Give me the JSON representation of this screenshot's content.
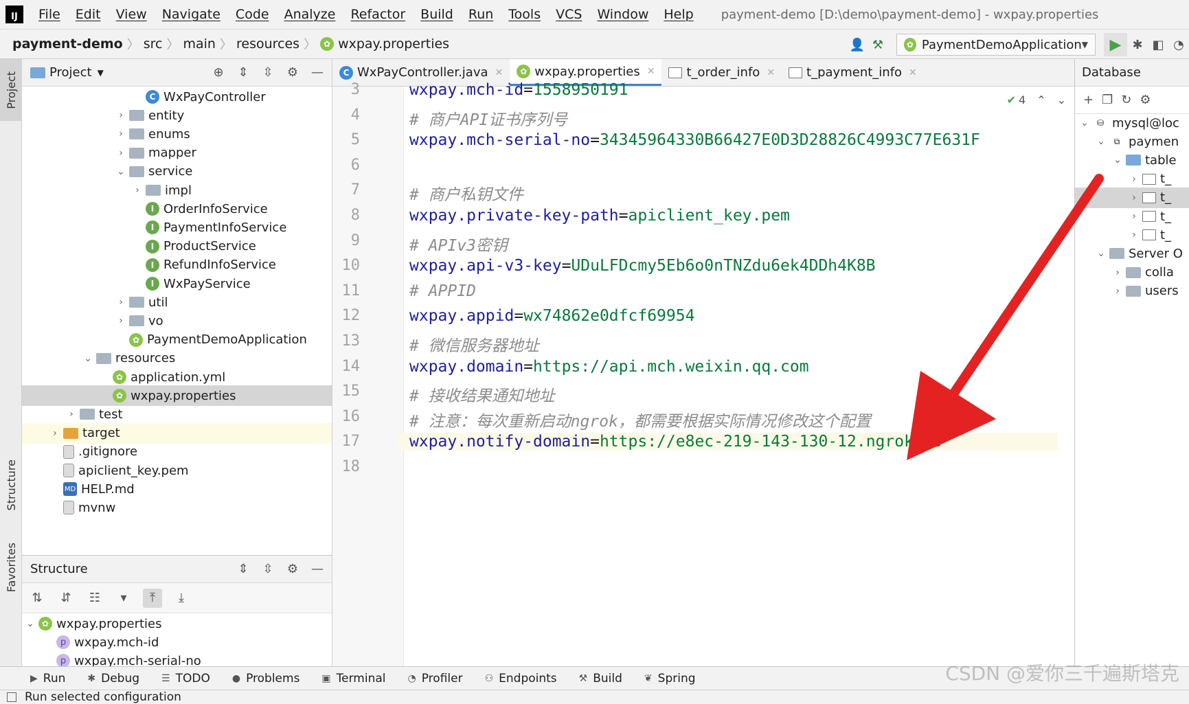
{
  "app": {
    "logo": "IJ",
    "menu": [
      "File",
      "Edit",
      "View",
      "Navigate",
      "Code",
      "Analyze",
      "Refactor",
      "Build",
      "Run",
      "Tools",
      "VCS",
      "Window",
      "Help"
    ],
    "window_title": "payment-demo [D:\\demo\\payment-demo] - wxpay.properties"
  },
  "breadcrumb": [
    "payment-demo",
    "src",
    "main",
    "resources",
    "wxpay.properties"
  ],
  "run_config": "PaymentDemoApplication",
  "left_stripe": {
    "project": "Project",
    "structure": "Structure",
    "favorites": "Favorites"
  },
  "project_panel": {
    "title": "Project",
    "tree": [
      {
        "label": "WxPayController",
        "indent": 7,
        "icon": "class",
        "arrow": ""
      },
      {
        "label": "entity",
        "indent": 6,
        "icon": "folder",
        "arrow": ">"
      },
      {
        "label": "enums",
        "indent": 6,
        "icon": "folder",
        "arrow": ">"
      },
      {
        "label": "mapper",
        "indent": 6,
        "icon": "folder",
        "arrow": ">"
      },
      {
        "label": "service",
        "indent": 6,
        "icon": "folder",
        "arrow": "v"
      },
      {
        "label": "impl",
        "indent": 7,
        "icon": "folder",
        "arrow": ">"
      },
      {
        "label": "OrderInfoService",
        "indent": 7,
        "icon": "iface",
        "arrow": ""
      },
      {
        "label": "PaymentInfoService",
        "indent": 7,
        "icon": "iface",
        "arrow": ""
      },
      {
        "label": "ProductService",
        "indent": 7,
        "icon": "iface",
        "arrow": ""
      },
      {
        "label": "RefundInfoService",
        "indent": 7,
        "icon": "iface",
        "arrow": ""
      },
      {
        "label": "WxPayService",
        "indent": 7,
        "icon": "iface",
        "arrow": ""
      },
      {
        "label": "util",
        "indent": 6,
        "icon": "folder",
        "arrow": ">"
      },
      {
        "label": "vo",
        "indent": 6,
        "icon": "folder",
        "arrow": ">"
      },
      {
        "label": "PaymentDemoApplication",
        "indent": 6,
        "icon": "spring",
        "arrow": ""
      },
      {
        "label": "resources",
        "indent": 4,
        "icon": "folder",
        "arrow": "v"
      },
      {
        "label": "application.yml",
        "indent": 5,
        "icon": "spring",
        "arrow": ""
      },
      {
        "label": "wxpay.properties",
        "indent": 5,
        "icon": "spring",
        "arrow": "",
        "selected": true
      },
      {
        "label": "test",
        "indent": 3,
        "icon": "folder",
        "arrow": ">"
      },
      {
        "label": "target",
        "indent": 2,
        "icon": "folder-orange",
        "arrow": ">",
        "highlight": true
      },
      {
        "label": ".gitignore",
        "indent": 2,
        "icon": "file",
        "arrow": ""
      },
      {
        "label": "apiclient_key.pem",
        "indent": 2,
        "icon": "file",
        "arrow": ""
      },
      {
        "label": "HELP.md",
        "indent": 2,
        "icon": "md",
        "arrow": ""
      },
      {
        "label": "mvnw",
        "indent": 2,
        "icon": "file",
        "arrow": ""
      }
    ]
  },
  "structure_panel": {
    "title": "Structure",
    "tree": [
      {
        "label": "wxpay.properties",
        "arrow": "v",
        "icon": "spring",
        "indent": 0
      },
      {
        "label": "wxpay.mch-id",
        "arrow": "",
        "icon": "prop",
        "indent": 1
      },
      {
        "label": "wxpay.mch-serial-no",
        "arrow": "",
        "icon": "prop",
        "indent": 1
      }
    ]
  },
  "editor_tabs": [
    {
      "label": "WxPayController.java",
      "icon": "class",
      "active": false
    },
    {
      "label": "wxpay.properties",
      "icon": "spring",
      "active": true
    },
    {
      "label": "t_order_info",
      "icon": "table",
      "active": false
    },
    {
      "label": "t_payment_info",
      "icon": "table",
      "active": false
    }
  ],
  "editor": {
    "inspection_count": "4",
    "lines": [
      {
        "no": "3",
        "key": "wxpay.mch-id",
        "eq": "=",
        "val": "1558950191",
        "comment": ""
      },
      {
        "no": "4",
        "key": "",
        "eq": "",
        "val": "",
        "comment": "# 商户API证书序列号"
      },
      {
        "no": "5",
        "key": "wxpay.mch-serial-no",
        "eq": "=",
        "val": "34345964330B66427E0D3D28826C4993C77E631F",
        "comment": ""
      },
      {
        "no": "6",
        "key": "",
        "eq": "",
        "val": "",
        "comment": ""
      },
      {
        "no": "7",
        "key": "",
        "eq": "",
        "val": "",
        "comment": "# 商户私钥文件"
      },
      {
        "no": "8",
        "key": "wxpay.private-key-path",
        "eq": "=",
        "val": "apiclient_key.pem",
        "comment": ""
      },
      {
        "no": "9",
        "key": "",
        "eq": "",
        "val": "",
        "comment": "# APIv3密钥"
      },
      {
        "no": "10",
        "key": "wxpay.api-v3-key",
        "eq": "=",
        "val": "UDuLFDcmy5Eb6o0nTNZdu6ek4DDh4K8B",
        "comment": ""
      },
      {
        "no": "11",
        "key": "",
        "eq": "",
        "val": "",
        "comment": "# APPID"
      },
      {
        "no": "12",
        "key": "wxpay.appid",
        "eq": "=",
        "val": "wx74862e0dfcf69954",
        "comment": ""
      },
      {
        "no": "13",
        "key": "",
        "eq": "",
        "val": "",
        "comment": "# 微信服务器地址"
      },
      {
        "no": "14",
        "key": "wxpay.domain",
        "eq": "=",
        "val": "https://api.mch.weixin.qq.com",
        "comment": ""
      },
      {
        "no": "15",
        "key": "",
        "eq": "",
        "val": "",
        "comment": "# 接收结果通知地址"
      },
      {
        "no": "16",
        "key": "",
        "eq": "",
        "val": "",
        "comment": "# 注意：每次重新启动ngrok，都需要根据实际情况修改这个配置"
      },
      {
        "no": "17",
        "key": "wxpay.notify-domain",
        "eq": "=",
        "val": "https://e8ec-219-143-130-12.ngrok.io",
        "comment": "",
        "current": true
      },
      {
        "no": "18",
        "key": "",
        "eq": "",
        "val": "",
        "comment": ""
      }
    ]
  },
  "database_panel": {
    "title": "Database",
    "tree": [
      {
        "label": "mysql@loc",
        "arrow": "v",
        "icon": "db",
        "indent": 0
      },
      {
        "label": "paymen",
        "arrow": "v",
        "icon": "schema",
        "indent": 1
      },
      {
        "label": "table",
        "arrow": "v",
        "icon": "folderblue",
        "indent": 2
      },
      {
        "label": "t_",
        "arrow": ">",
        "icon": "table",
        "indent": 3
      },
      {
        "label": "t_",
        "arrow": ">",
        "icon": "table",
        "indent": 3,
        "selected": true
      },
      {
        "label": "t_",
        "arrow": ">",
        "icon": "table",
        "indent": 3
      },
      {
        "label": "t_",
        "arrow": ">",
        "icon": "table",
        "indent": 3
      },
      {
        "label": "Server O",
        "arrow": "v",
        "icon": "folder",
        "indent": 1
      },
      {
        "label": "colla",
        "arrow": ">",
        "icon": "folder",
        "indent": 2
      },
      {
        "label": "users",
        "arrow": ">",
        "icon": "folder",
        "indent": 2
      }
    ]
  },
  "bottom_tools": [
    {
      "label": "Run",
      "icon": "▶"
    },
    {
      "label": "Debug",
      "icon": "✱"
    },
    {
      "label": "TODO",
      "icon": "☰"
    },
    {
      "label": "Problems",
      "icon": "●"
    },
    {
      "label": "Terminal",
      "icon": "▣"
    },
    {
      "label": "Profiler",
      "icon": "◔"
    },
    {
      "label": "Endpoints",
      "icon": "⚇"
    },
    {
      "label": "Build",
      "icon": "⚒"
    },
    {
      "label": "Spring",
      "icon": "❦"
    }
  ],
  "status": "Run selected configuration",
  "watermark": "CSDN @爱你三千遍斯塔克",
  "colors": {
    "accent": "#4083c9",
    "key": "#1e1e9e",
    "value": "#087a3c",
    "comment": "#8c8c8c",
    "arrow": "#e52222"
  }
}
